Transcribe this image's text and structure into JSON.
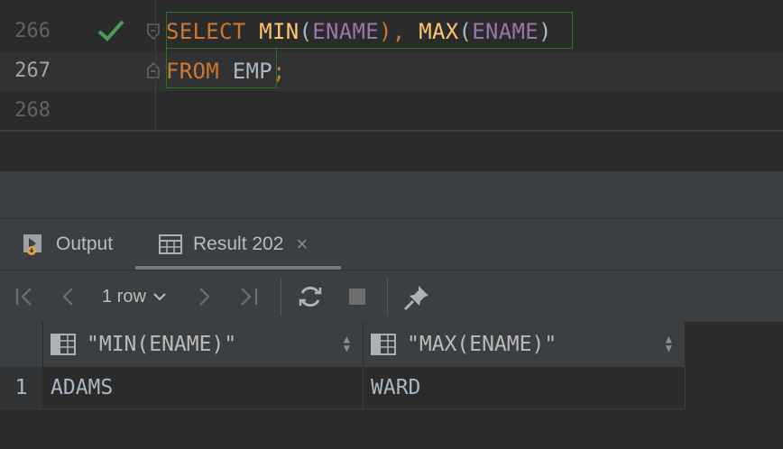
{
  "editor": {
    "lines": [
      {
        "number": "266",
        "status": "check-icon"
      },
      {
        "number": "267"
      },
      {
        "number": "268"
      }
    ],
    "code": {
      "l1_kw": "SELECT",
      "l1_fn1": "MIN",
      "l1_p1": "(",
      "l1_col1": "ENAME",
      "l1_p2": "), ",
      "l1_fn2": "MAX",
      "l1_p3": "(",
      "l1_col2": "ENAME",
      "l1_p4": ")",
      "l2_kw": "FROM",
      "l2_tbl": "EMP",
      "l2_semi": ";"
    }
  },
  "tabs": {
    "output_label": "Output",
    "result_label": "Result 202",
    "close_glyph": "×"
  },
  "toolbar": {
    "rows_label": "1 row",
    "first": "|<",
    "prev": "<",
    "next": ">",
    "last": ">|"
  },
  "grid": {
    "columns": [
      "\"MIN(ENAME)\"",
      "\"MAX(ENAME)\""
    ],
    "rows": [
      {
        "num": "1",
        "cells": [
          "ADAMS",
          "WARD"
        ]
      }
    ]
  },
  "colors": {
    "keyword": "#cc7832",
    "function": "#ffc66d",
    "column": "#9876aa",
    "check": "#499c54",
    "selection_border": "#1f7a1f"
  }
}
